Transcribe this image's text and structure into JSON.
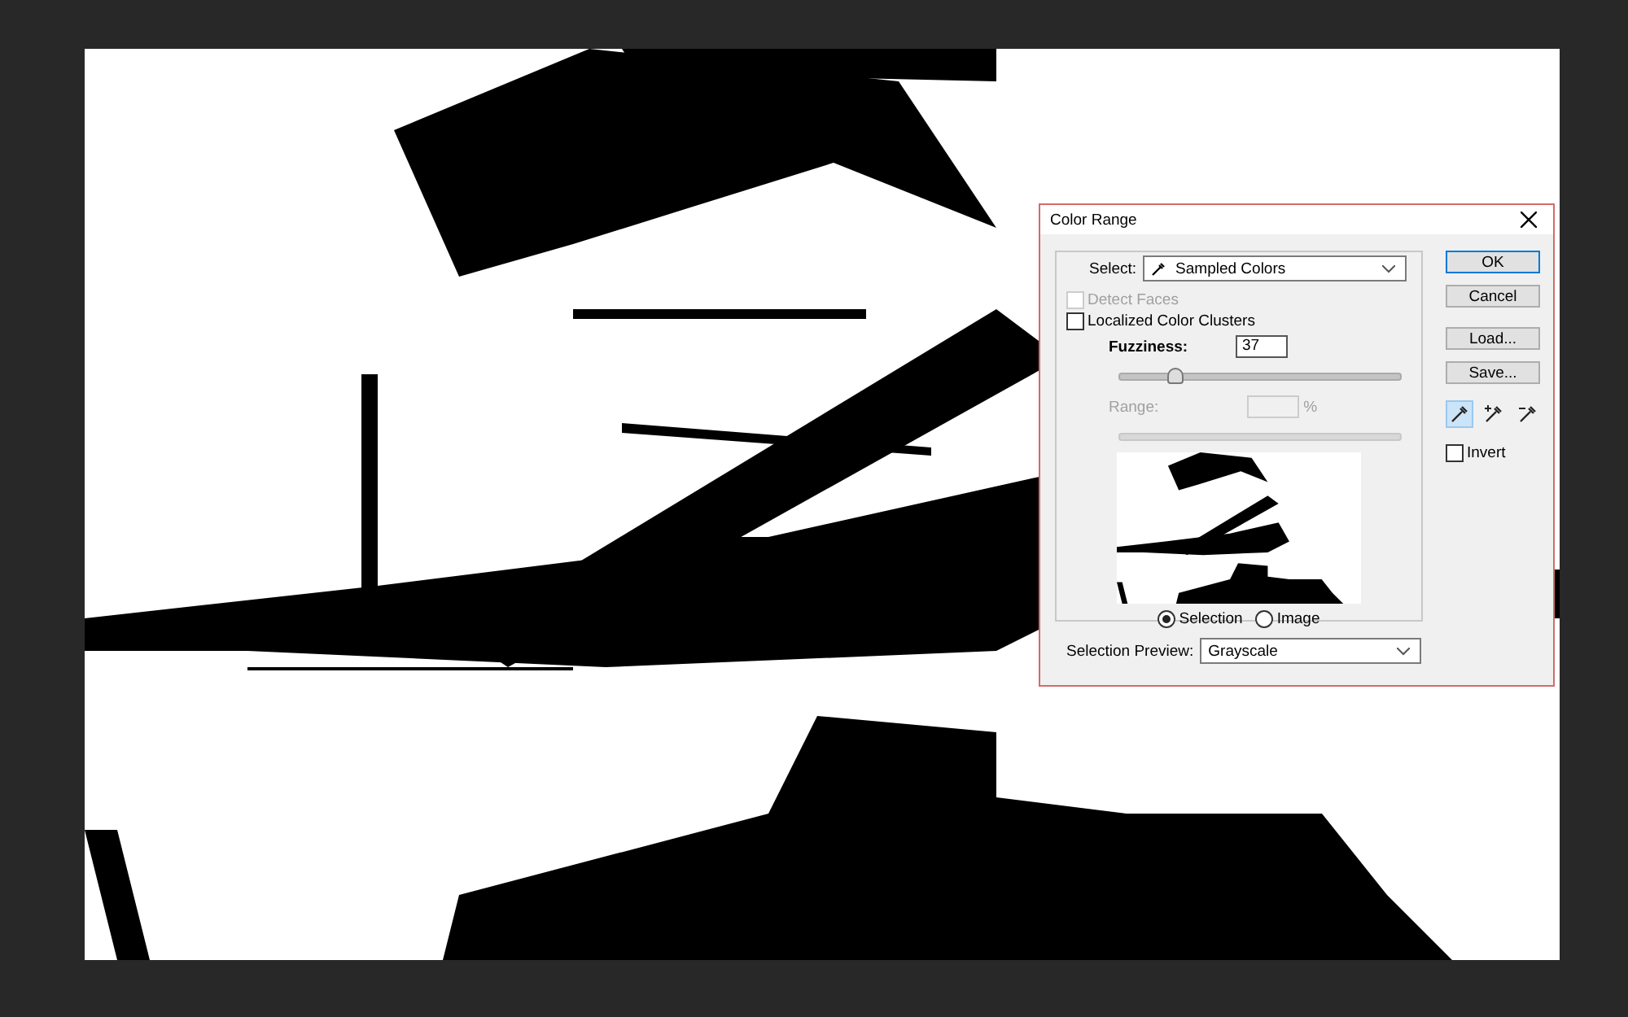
{
  "dialog": {
    "title": "Color Range",
    "select": {
      "label": "Select:",
      "value": "Sampled Colors"
    },
    "options": [
      {
        "kind": "checkbox",
        "label": "Detect Faces",
        "checked": false,
        "disabled": true
      },
      {
        "kind": "checkbox",
        "label": "Localized Color Clusters",
        "checked": false,
        "disabled": false
      }
    ],
    "fuzziness": {
      "label": "Fuzziness:",
      "value": "37",
      "level": 0.19
    },
    "range": {
      "label": "Range:",
      "unit": "%",
      "disabled": true
    },
    "preview_modes": [
      {
        "label": "Selection",
        "selected": true
      },
      {
        "label": "Image",
        "selected": false
      }
    ],
    "selection_preview": {
      "label": "Selection Preview:",
      "value": "Grayscale"
    },
    "buttons": [
      {
        "label": "OK",
        "default": true
      },
      {
        "label": "Cancel",
        "default": false
      },
      {
        "label": "Load...",
        "default": false
      },
      {
        "label": "Save...",
        "default": false
      }
    ],
    "eyedroppers": [
      {
        "kind": "plain",
        "selected": true
      },
      {
        "kind": "add",
        "selected": false
      },
      {
        "kind": "subtract",
        "selected": false
      }
    ],
    "invert": {
      "label": "Invert",
      "checked": false
    }
  }
}
